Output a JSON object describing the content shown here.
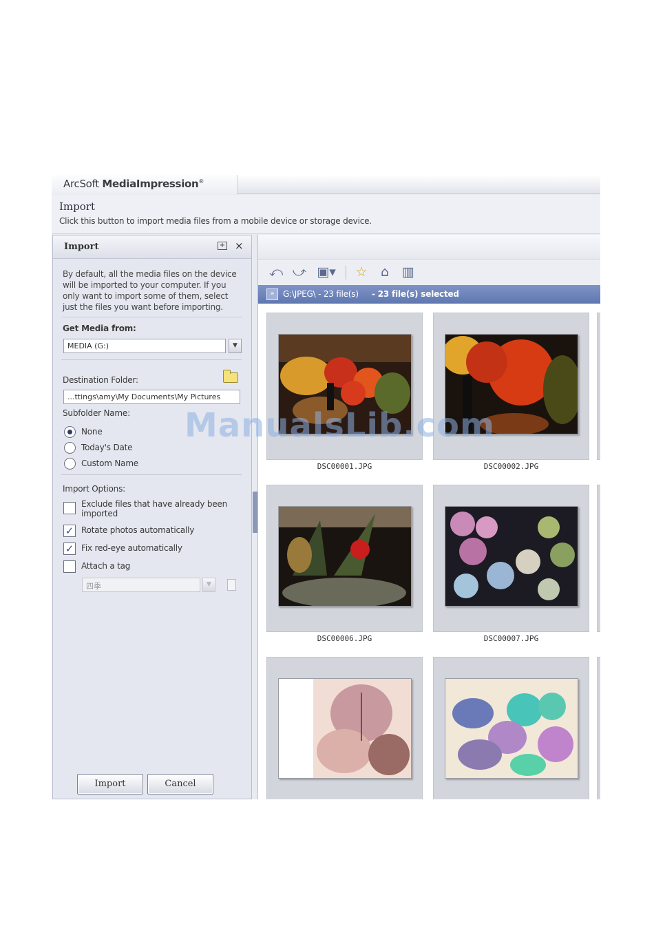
{
  "app": {
    "brand_light": "ArcSoft ",
    "brand_bold": "MediaImpression",
    "brand_mark": "®"
  },
  "header": {
    "title": "Import",
    "description": "Click this button to import media files from a mobile device or storage device."
  },
  "panel": {
    "title": "Import",
    "dock_icon": "dock-icon",
    "close_label": "×",
    "intro_lines": [
      "By default, all the media files on the device",
      "will be imported to your computer. If you",
      "only want to import some of them, select",
      "just the files you want before importing."
    ],
    "get_media_label": "Get Media from:",
    "get_media_value": "MEDIA (G:)",
    "destination_label": "Destination Folder:",
    "destination_value": "...ttings\\amy\\My Documents\\My Pictures",
    "subfolder_label": "Subfolder Name:",
    "subfolder_options": [
      {
        "label": "None",
        "selected": true
      },
      {
        "label": "Today's Date",
        "selected": false
      },
      {
        "label": "Custom Name",
        "selected": false
      }
    ],
    "import_options_label": "Import Options:",
    "options": [
      {
        "label_1": "Exclude files that have already been",
        "label_2": "imported",
        "checked": false
      },
      {
        "label_1": "Rotate photos automatically",
        "checked": true
      },
      {
        "label_1": "Fix red-eye automatically",
        "checked": true
      },
      {
        "label_1": "Attach a tag",
        "checked": false
      }
    ],
    "tag_value": "四季",
    "check_mark": "✓",
    "import_button": "Import",
    "cancel_button": "Cancel"
  },
  "browser": {
    "path": "G:\\JPEG\\ - 23 file(s)",
    "selected": "- 23 file(s) selected",
    "path_arrow": "»",
    "toolbar_icons": [
      "rotate-left-icon",
      "rotate-right-icon",
      "view-mode-icon",
      "star-icon",
      "tag-icon",
      "delete-icon"
    ],
    "files": [
      {
        "name": "DSC00001.JPG"
      },
      {
        "name": "DSC00002.JPG"
      },
      {
        "name": "DSC00006.JPG"
      },
      {
        "name": "DSC00007.JPG"
      },
      {
        "name": ""
      },
      {
        "name": ""
      }
    ]
  },
  "watermark": "ManualsLib.com"
}
